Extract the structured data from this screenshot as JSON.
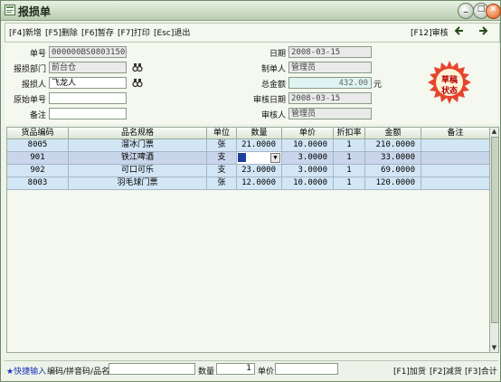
{
  "window": {
    "title": "报损单",
    "min_glyph": "_",
    "max_glyph": "□",
    "close_glyph": "×"
  },
  "toolbar": {
    "add": "[F4]新增",
    "delete": "[F5]删除",
    "draft": "[F6]暂存",
    "print": "[F7]打印",
    "exit": "[Esc]退出",
    "audit": "[F12]审核",
    "prev_glyph": "◆",
    "next_glyph": "◆"
  },
  "form": {
    "doc_no_label": "单号",
    "doc_no": "000000BS0803150003",
    "dept_label": "报损部门",
    "dept": "前台仓",
    "reporter_label": "报损人",
    "reporter": "飞龙人",
    "orig_no_label": "原始单号",
    "orig_no": "",
    "remark_label": "备注",
    "remark": "",
    "date_label": "日期",
    "date": "2008-03-15",
    "maker_label": "制单人",
    "maker": "管理员",
    "total_label": "总金额",
    "total": "432.00",
    "total_unit": "元",
    "audit_date_label": "审核日期",
    "audit_date": "2008-03-15",
    "auditor_label": "审核人",
    "auditor": "管理员"
  },
  "stamp": {
    "line1": "草稿",
    "line2": "状态",
    "color": "#d03a2a"
  },
  "table": {
    "headers": [
      "货品编码",
      "品名规格",
      "单位",
      "数量",
      "单价",
      "折扣率",
      "金额",
      "备注"
    ],
    "rows": [
      {
        "code": "8005",
        "name": "溜冰门票",
        "unit": "张",
        "qty": "21.0000",
        "price": "10.0000",
        "discount": "1",
        "amount": "210.0000",
        "note": ""
      },
      {
        "code": "901",
        "name": "铁江啤酒",
        "unit": "支",
        "qty": "",
        "price": "3.0000",
        "discount": "1",
        "amount": "33.0000",
        "note": ""
      },
      {
        "code": "902",
        "name": "可口可乐",
        "unit": "支",
        "qty": "23.0000",
        "price": "3.0000",
        "discount": "1",
        "amount": "69.0000",
        "note": ""
      },
      {
        "code": "8003",
        "name": "羽毛球门票",
        "unit": "张",
        "qty": "12.0000",
        "price": "10.0000",
        "discount": "1",
        "amount": "120.0000",
        "note": ""
      }
    ],
    "selected_row": 1
  },
  "status": {
    "quick_input": "★快捷输入",
    "search_hint": "编码/拼音码/品名",
    "qty_label": "数量",
    "qty_value": "1",
    "price_label": "单价",
    "price_value": "",
    "add_goods": "[F1]加货",
    "remove_goods": "[F2]减货",
    "sum": "[F3]合计"
  }
}
